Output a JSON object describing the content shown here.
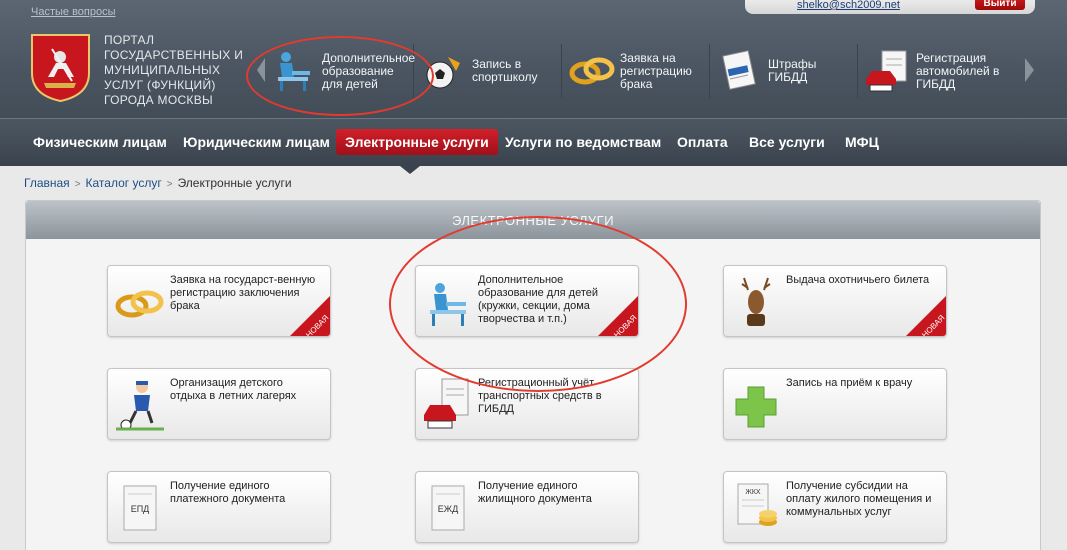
{
  "header": {
    "faq_link": "Частые вопросы",
    "user_email": "shelko@sch2009.net",
    "logout_label": "Выйти",
    "portal_name": "ПОРТАЛ ГОСУДАРСТВЕННЫХ И МУНИЦИПАЛЬНЫХ УСЛУГ (ФУНКЦИЙ) ГОРОДА МОСКВЫ",
    "carousel": [
      {
        "label": "Дополнительное образование для детей",
        "icon": "student-desk-icon"
      },
      {
        "label": "Запись в спортшколу",
        "icon": "soccer-ball-icon"
      },
      {
        "label": "Заявка на регистрацию брака",
        "icon": "wedding-rings-icon"
      },
      {
        "label": "Штрафы ГИБДД",
        "icon": "fine-document-icon"
      },
      {
        "label": "Регистрация автомобилей в ГИБДД",
        "icon": "car-registration-icon"
      }
    ]
  },
  "nav": {
    "items": [
      {
        "label": "Физическим лицам"
      },
      {
        "label": "Юридическим лицам"
      },
      {
        "label": "Электронные услуги"
      },
      {
        "label": "Услуги по ведомствам"
      },
      {
        "label": "Оплата"
      },
      {
        "label": "Все услуги"
      },
      {
        "label": "МФЦ"
      }
    ],
    "active_index": 2
  },
  "breadcrumb": {
    "home": "Главная",
    "catalog": "Каталог услуг",
    "current": "Электронные услуги"
  },
  "services": {
    "title": "ЭЛЕКТРОННЫЕ УСЛУГИ",
    "new_badge": "НОВАЯ",
    "cards": [
      {
        "label": "Заявка на государст-венную регистрацию заключения брака",
        "icon": "wedding-rings-icon",
        "is_new": true
      },
      {
        "label": "Дополнительное образование для детей (кружки, секции, дома творчества и т.п.)",
        "icon": "student-desk-icon",
        "is_new": true
      },
      {
        "label": "Выдача охотничьего билета",
        "icon": "deer-head-icon",
        "is_new": true
      },
      {
        "label": "Организация детского отдыха в летних лагерях",
        "icon": "kid-soccer-icon",
        "is_new": false
      },
      {
        "label": "Регистрационный учёт транспортных средств в ГИБДД",
        "icon": "car-registration-icon",
        "is_new": false
      },
      {
        "label": "Запись на приём к врачу",
        "icon": "medical-cross-icon",
        "is_new": false
      },
      {
        "label": "Получение единого платежного документа",
        "icon": "epd-document-icon",
        "doc_code": "ЕПД",
        "is_new": false
      },
      {
        "label": "Получение единого жилищного документа",
        "icon": "ezhd-document-icon",
        "doc_code": "ЕЖД",
        "is_new": false
      },
      {
        "label": "Получение субсидии на оплату жилого помещения и коммунальных услуг",
        "icon": "subsidy-coins-icon",
        "doc_code": "ЖКХ",
        "is_new": false
      }
    ]
  },
  "colors": {
    "accent_red": "#c8161e",
    "header_bg": "#4a5561",
    "link_blue": "#1d4f86",
    "annotation_red": "#e23b2e"
  }
}
